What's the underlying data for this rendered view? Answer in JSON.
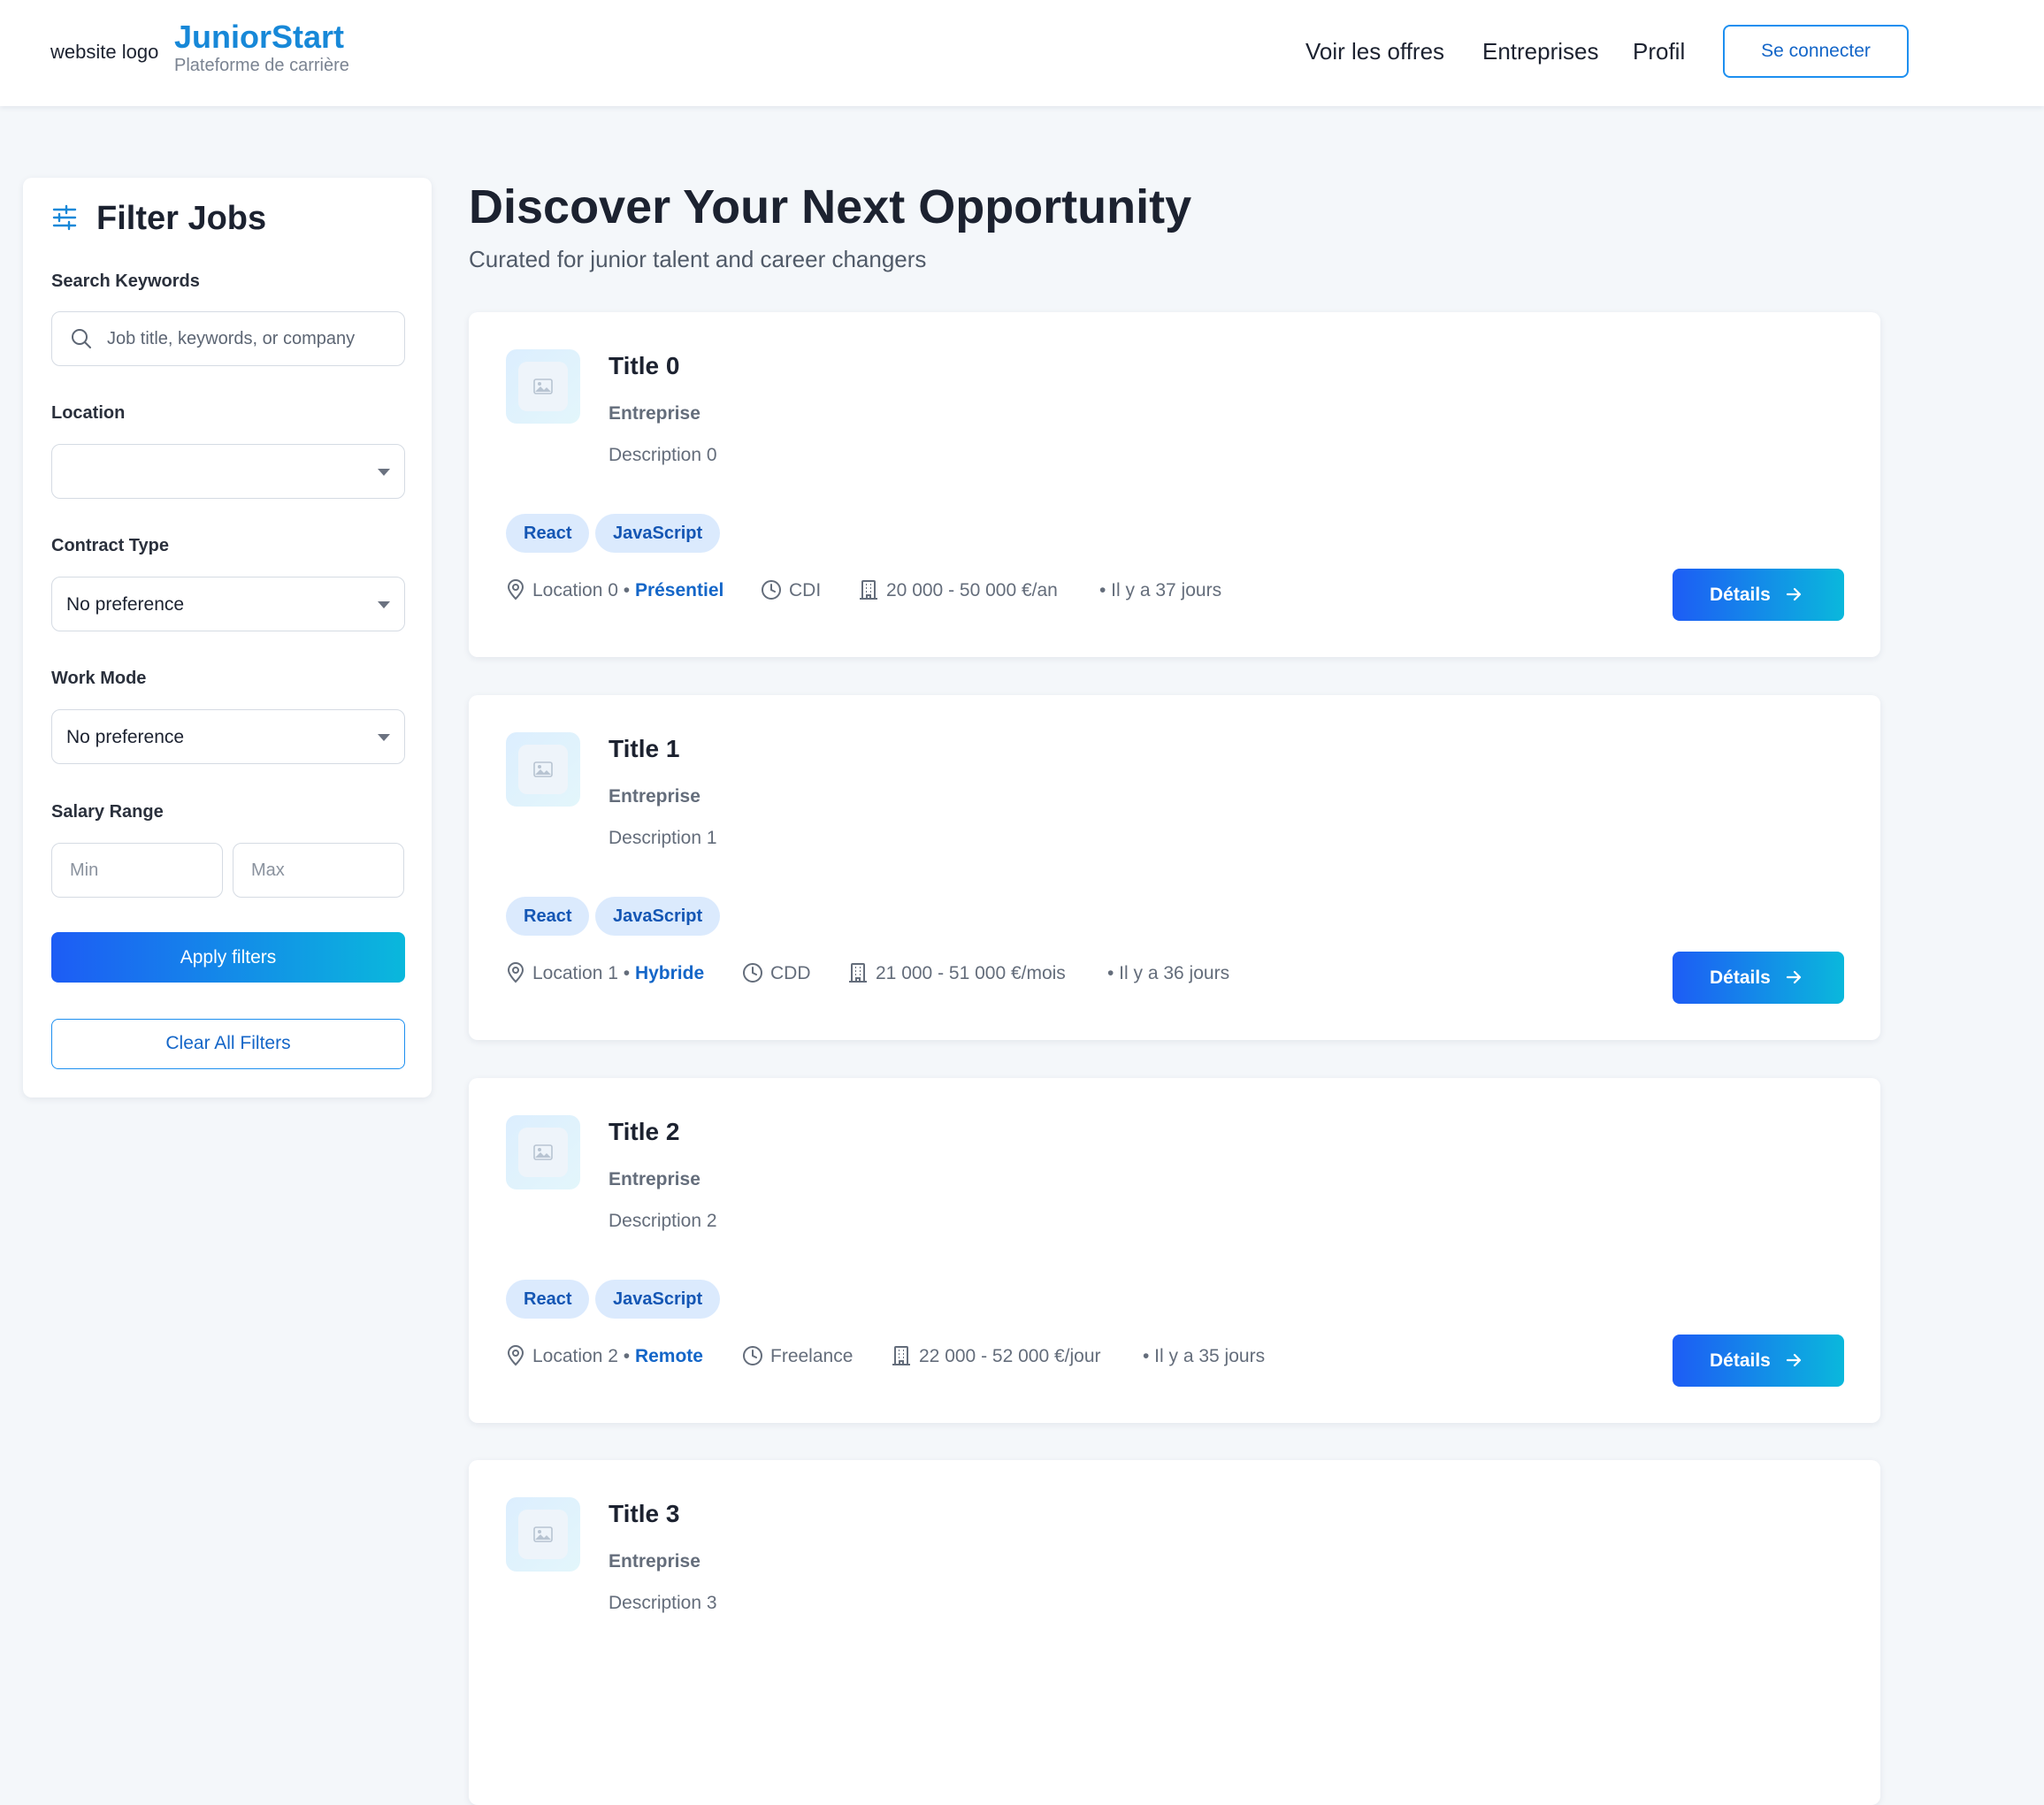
{
  "header": {
    "logo_text": "website logo",
    "brand_name": "JuniorStart",
    "brand_tagline": "Plateforme de carrière",
    "nav": [
      "Voir les offres",
      "Entreprises",
      "Profil"
    ],
    "login_label": "Se connecter"
  },
  "sidebar": {
    "title": "Filter Jobs",
    "keywords_label": "Search Keywords",
    "keywords_placeholder": "Job title, keywords, or company",
    "location_label": "Location",
    "location_value": "",
    "contract_label": "Contract Type",
    "contract_value": "No preference",
    "workmode_label": "Work Mode",
    "workmode_value": "No preference",
    "salary_label": "Salary Range",
    "salary_min_placeholder": "Min",
    "salary_max_placeholder": "Max",
    "apply_label": "Apply filters",
    "clear_label": "Clear All Filters"
  },
  "main": {
    "title": "Discover Your Next Opportunity",
    "subtitle": "Curated for junior talent and career changers",
    "details_label": "Détails",
    "jobs": [
      {
        "title": "Title 0",
        "company": "Entreprise",
        "description": "Description 0",
        "tags": [
          "React",
          "JavaScript"
        ],
        "location": "Location 0",
        "mode": "Présentiel",
        "contract": "CDI",
        "salary": "20 000 - 50 000 €/an",
        "posted": "• Il y a 37 jours"
      },
      {
        "title": "Title 1",
        "company": "Entreprise",
        "description": "Description 1",
        "tags": [
          "React",
          "JavaScript"
        ],
        "location": "Location 1",
        "mode": "Hybride",
        "contract": "CDD",
        "salary": "21 000 - 51 000 €/mois",
        "posted": "• Il y a 36 jours"
      },
      {
        "title": "Title 2",
        "company": "Entreprise",
        "description": "Description 2",
        "tags": [
          "React",
          "JavaScript"
        ],
        "location": "Location 2",
        "mode": "Remote",
        "contract": "Freelance",
        "salary": "22 000 - 52 000 €/jour",
        "posted": "• Il y a 35 jours"
      },
      {
        "title": "Title 3",
        "company": "Entreprise",
        "description": "Description 3"
      }
    ]
  },
  "colors": {
    "brand": "#1788d8",
    "accent_blue": "#1466c8",
    "gradient_start": "#1d5cf5",
    "gradient_end": "#0ab8dc",
    "tag_bg": "#dbeafd",
    "page_bg": "#f4f7fa"
  },
  "icons": [
    "sliders-icon",
    "search-icon",
    "chevron-down-icon",
    "image-placeholder-icon",
    "map-pin-icon",
    "clock-icon",
    "building-icon",
    "arrow-right-icon"
  ]
}
